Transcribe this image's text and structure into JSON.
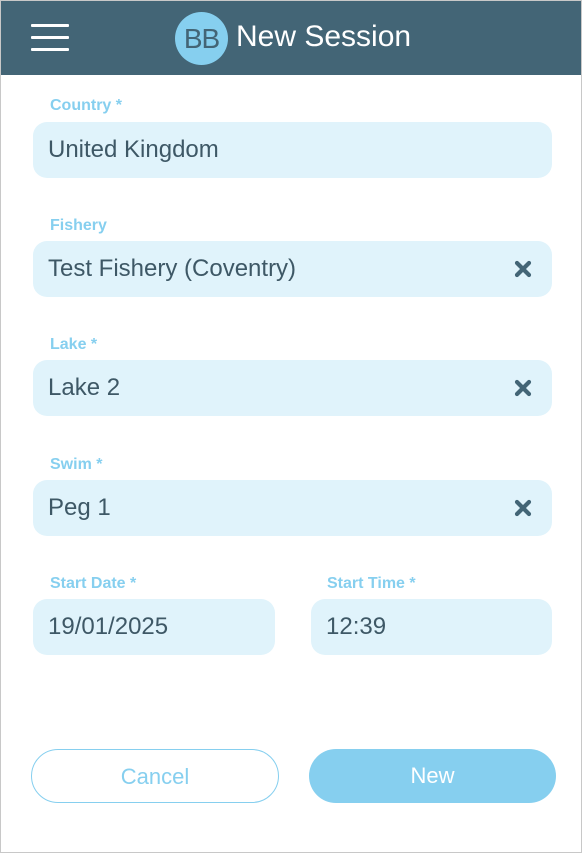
{
  "header": {
    "logo_text": "BB",
    "title": "New Session"
  },
  "form": {
    "country": {
      "label": "Country *",
      "value": "United Kingdom"
    },
    "fishery": {
      "label": "Fishery",
      "value": "Test Fishery (Coventry)"
    },
    "lake": {
      "label": "Lake *",
      "value": "Lake 2"
    },
    "swim": {
      "label": "Swim *",
      "value": "Peg 1"
    },
    "start_date": {
      "label": "Start Date *",
      "value": "19/01/2025"
    },
    "start_time": {
      "label": "Start Time *",
      "value": "12:39"
    }
  },
  "buttons": {
    "cancel": "Cancel",
    "new": "New"
  },
  "colors": {
    "header_bg": "#436576",
    "accent": "#86cfef",
    "field_bg": "#e0f3fb",
    "field_text": "#3e5866"
  },
  "icons": {
    "menu": "hamburger-menu-icon",
    "clear": "close-x-icon"
  }
}
